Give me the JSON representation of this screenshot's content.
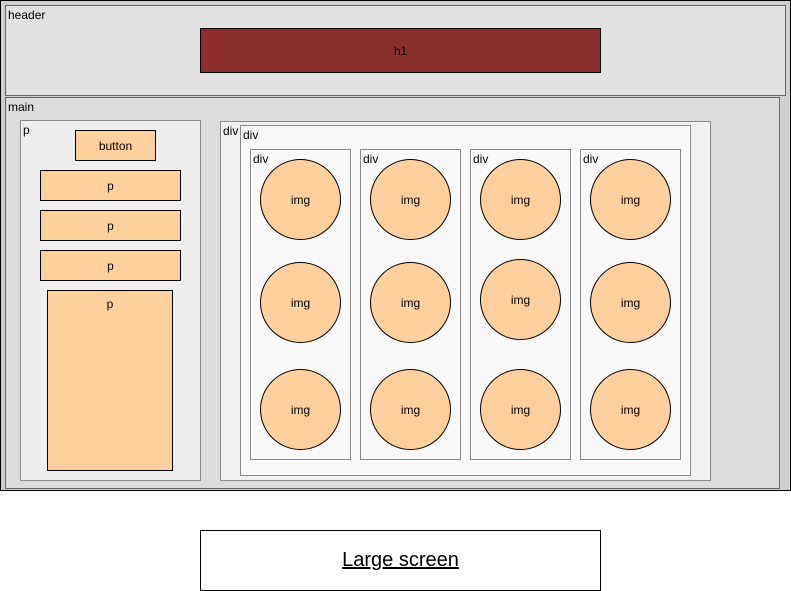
{
  "outer": {},
  "header": {
    "label": "header",
    "h1": "h1"
  },
  "main": {
    "label": "main",
    "p_column": {
      "label": "p",
      "button": "button",
      "paragraphs": [
        "p",
        "p",
        "p",
        "p"
      ]
    },
    "div_outer": {
      "label": "div",
      "div_inner": {
        "label": "div",
        "columns": [
          {
            "label": "div",
            "imgs": [
              "img",
              "img",
              "img"
            ]
          },
          {
            "label": "div",
            "imgs": [
              "img",
              "img",
              "img"
            ]
          },
          {
            "label": "div",
            "imgs": [
              "img",
              "img",
              "img"
            ]
          },
          {
            "label": "div",
            "imgs": [
              "img",
              "img",
              "img"
            ]
          }
        ]
      }
    }
  },
  "caption": "Large screen",
  "colors": {
    "h1_fill": "#8B2E2E",
    "element_fill": "#FFD09E",
    "container_fill": "#DCDCDC"
  }
}
